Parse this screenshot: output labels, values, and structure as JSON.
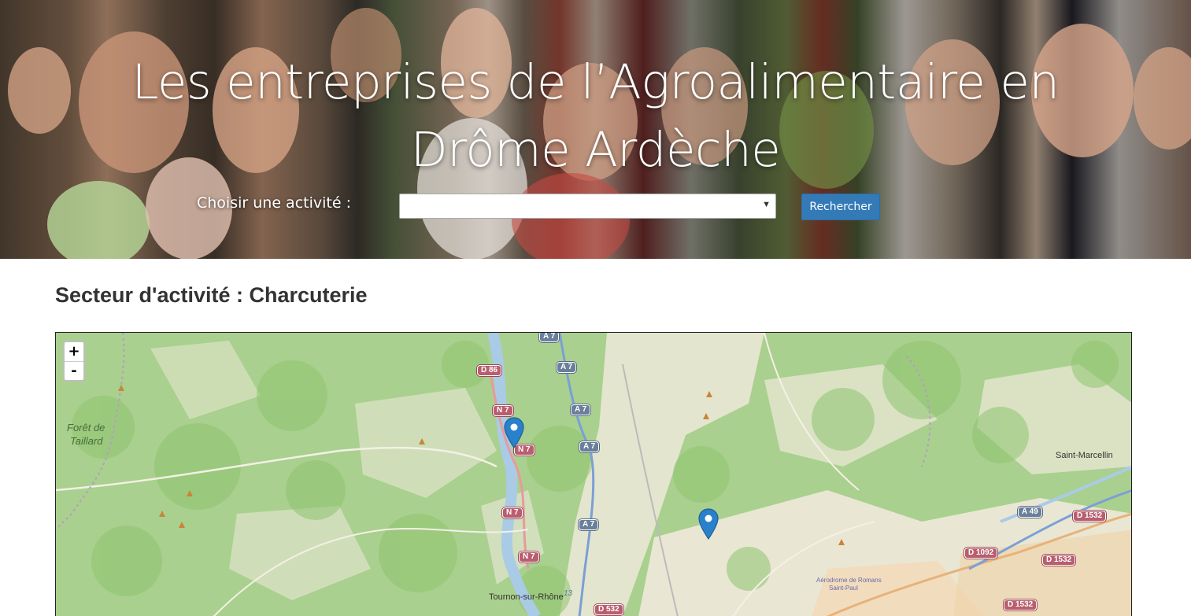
{
  "hero": {
    "title_line1": "Les entreprises de l’Agroalimentaire en",
    "title_line2": "Drôme Ardèche",
    "activity_label": "Choisir une activité :",
    "activity_select_value": "",
    "search_button": "Rechercher"
  },
  "sector_heading": "Secteur d'activité : Charcuterie",
  "map": {
    "zoom_in": "+",
    "zoom_out": "-",
    "place_labels": [
      "Forêt de",
      "Taillard",
      "Saint-Marcellin",
      "Tournon-sur-Rhône",
      "Aérodrome de Romans",
      "Saint-Paul"
    ],
    "road_shields": [
      {
        "label": "A 7",
        "type": "a"
      },
      {
        "label": "A 7",
        "type": "a"
      },
      {
        "label": "D 86",
        "type": "n"
      },
      {
        "label": "A 7",
        "type": "a"
      },
      {
        "label": "N 7",
        "type": "n"
      },
      {
        "label": "A 7",
        "type": "a"
      },
      {
        "label": "N 7",
        "type": "n"
      },
      {
        "label": "N 7",
        "type": "n"
      },
      {
        "label": "A 7",
        "type": "a"
      },
      {
        "label": "N 7",
        "type": "n"
      },
      {
        "label": "A 49",
        "type": "a"
      },
      {
        "label": "D 1532",
        "type": "n"
      },
      {
        "label": "D 1092",
        "type": "n"
      },
      {
        "label": "D 1532",
        "type": "n"
      },
      {
        "label": "D 532",
        "type": "n"
      },
      {
        "label": "D 1532",
        "type": "n"
      }
    ],
    "road_number": "13",
    "markers": [
      "marker-1",
      "marker-2"
    ],
    "colors": {
      "forest": "#a9d08e",
      "land": "#efe9da",
      "river": "#aacbe6",
      "marker": "#2a81cb"
    }
  }
}
